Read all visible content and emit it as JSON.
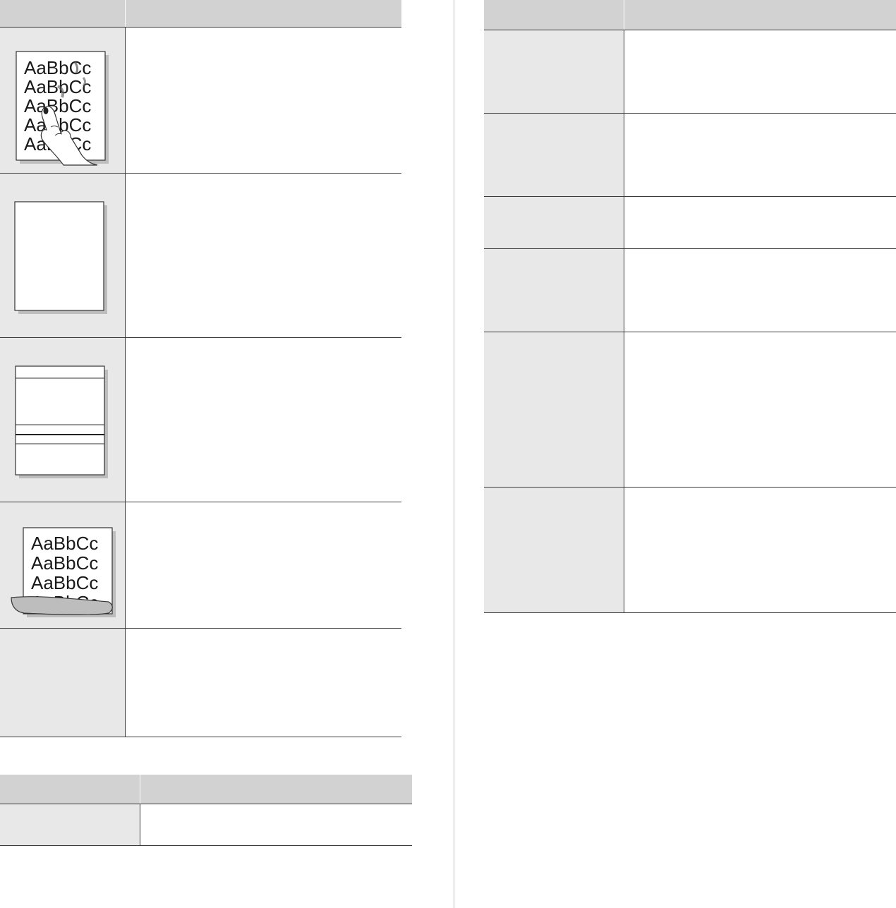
{
  "left_table": {
    "header": [
      "",
      ""
    ],
    "rows": [
      {
        "illustration": "smeared-toner-page",
        "sample_lines": [
          "AaBbCc",
          "AaBbCc",
          "AaBbCc",
          "AaBbCc",
          "AaBbCc"
        ]
      },
      {
        "illustration": "blank-page"
      },
      {
        "illustration": "horizontal-lines-page"
      },
      {
        "illustration": "curled-page",
        "sample_lines": [
          "AaBbCc",
          "AaBbCc",
          "AaBbCc",
          "AaBbCc"
        ]
      },
      {
        "illustration": "none"
      }
    ]
  },
  "bottom_table": {
    "header": [
      "",
      ""
    ],
    "rows": [
      {
        "cells": [
          "",
          ""
        ]
      }
    ]
  },
  "right_table": {
    "header": [
      "",
      ""
    ],
    "rows": [
      {
        "cells": [
          "",
          ""
        ]
      },
      {
        "cells": [
          "",
          ""
        ]
      },
      {
        "cells": [
          "",
          ""
        ]
      },
      {
        "cells": [
          "",
          ""
        ]
      },
      {
        "cells": [
          "",
          ""
        ]
      },
      {
        "cells": [
          "",
          ""
        ]
      }
    ]
  }
}
